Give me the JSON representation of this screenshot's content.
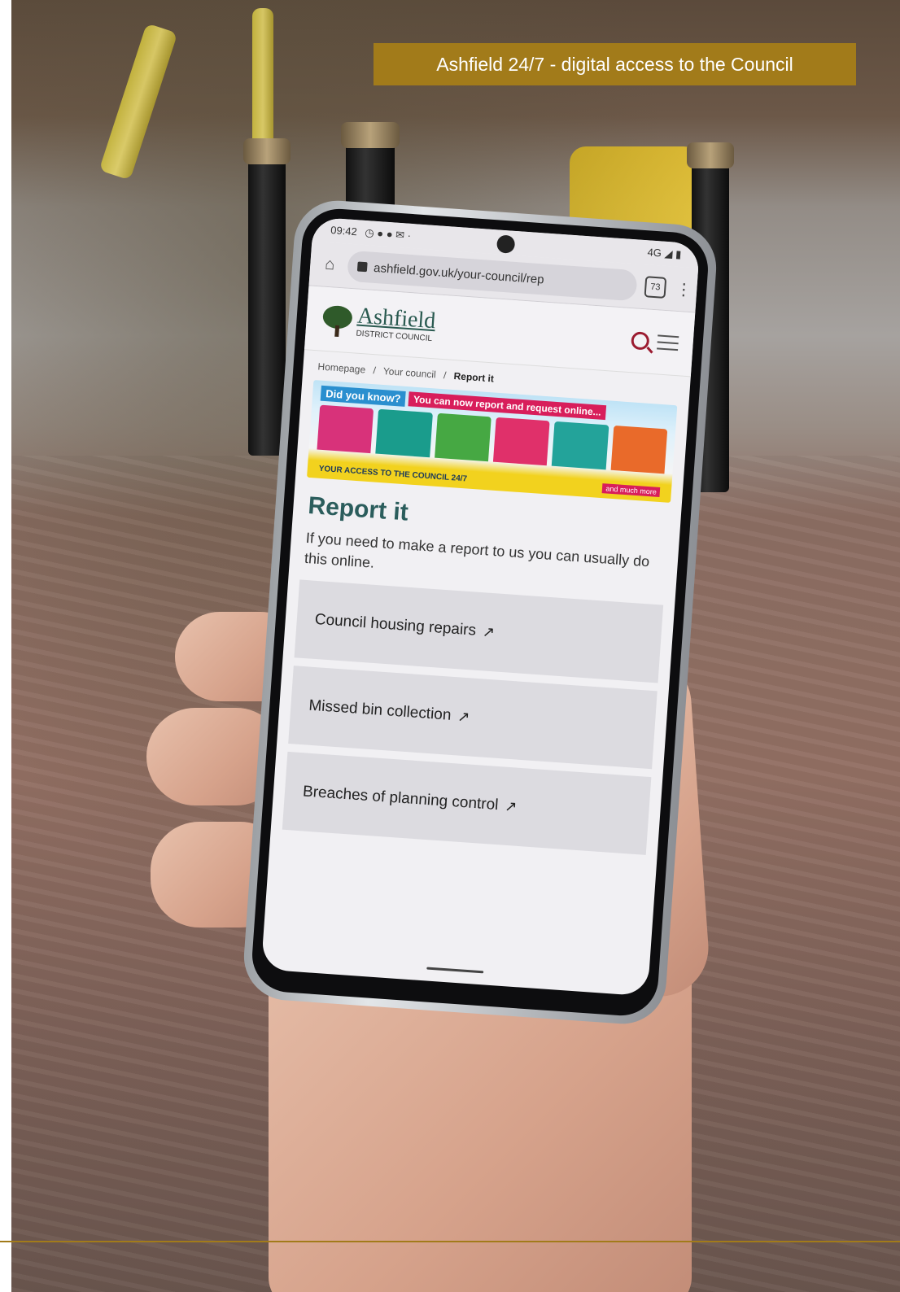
{
  "caption": "Ashfield 24/7 - digital access to the Council",
  "phone": {
    "status": {
      "time": "09:42",
      "network": "4G"
    },
    "browser": {
      "url": "ashfield.gov.uk/your-council/rep",
      "tab_count": "73"
    },
    "site": {
      "logo_name": "Ashfield",
      "logo_subtitle": "DISTRICT COUNCIL",
      "breadcrumb": [
        "Homepage",
        "/",
        "Your council",
        "/",
        "Report it"
      ],
      "banner": {
        "did_you_know": "Did you know?",
        "headline": "You can now report and request online...",
        "footer": "YOUR ACCESS TO THE COUNCIL 24/7",
        "more": "and much more"
      },
      "title": "Report it",
      "intro": "If you need to make a report to us you can usually do this online.",
      "links": [
        "Council housing repairs",
        "Missed bin collection",
        "Breaches of planning control"
      ]
    }
  },
  "colors": {
    "caption_bg": "#a27b1a",
    "title_teal": "#2b5d5c",
    "search_red": "#9b1b30"
  }
}
